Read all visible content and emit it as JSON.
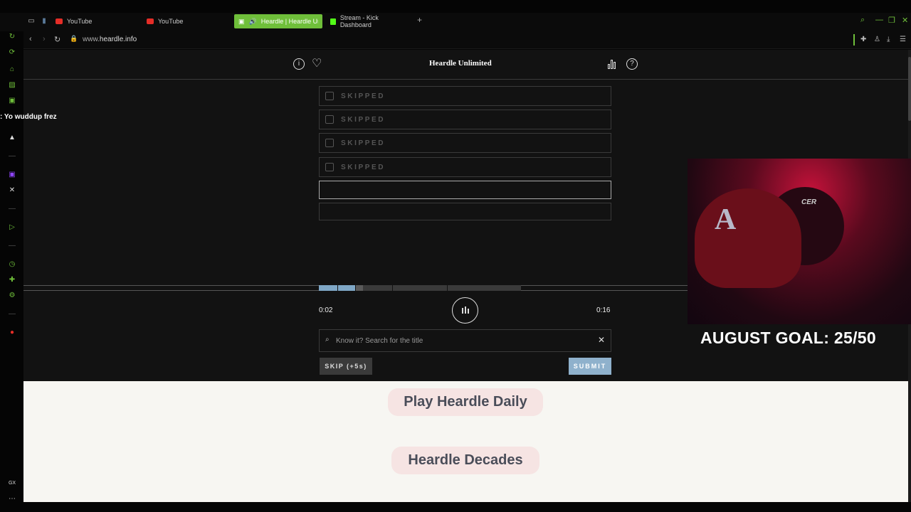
{
  "browser": {
    "tabs": [
      {
        "label": "YouTube",
        "icon": "youtube-icon"
      },
      {
        "label": "YouTube",
        "icon": "youtube-icon"
      },
      {
        "label": "Heardle | Heardle Un",
        "icon": "heardle-icon"
      },
      {
        "label": "Stream - Kick Dashboard",
        "icon": "kick-icon"
      }
    ],
    "url_prefix": "www.",
    "url_host": "heardle.info",
    "accent_color": "#6fbf3a"
  },
  "header": {
    "title": "Heardle Unlimited"
  },
  "guesses": [
    {
      "label": "SKIPPED"
    },
    {
      "label": "SKIPPED"
    },
    {
      "label": "SKIPPED"
    },
    {
      "label": "SKIPPED"
    },
    {
      "label": ""
    },
    {
      "label": ""
    }
  ],
  "player": {
    "current_time": "0:02",
    "total_time": "0:16",
    "played_fraction": 0.125
  },
  "search": {
    "placeholder": "Know it? Search for the title"
  },
  "buttons": {
    "skip": "SKIP (+5s)",
    "submit": "SUBMIT"
  },
  "links": {
    "daily": "Play Heardle Daily",
    "decades": "Heardle Decades"
  },
  "overlay": {
    "chat_message": ": Yo wuddup frez",
    "goal": "AUGUST GOAL: 25/50",
    "hat_text": "CER"
  }
}
